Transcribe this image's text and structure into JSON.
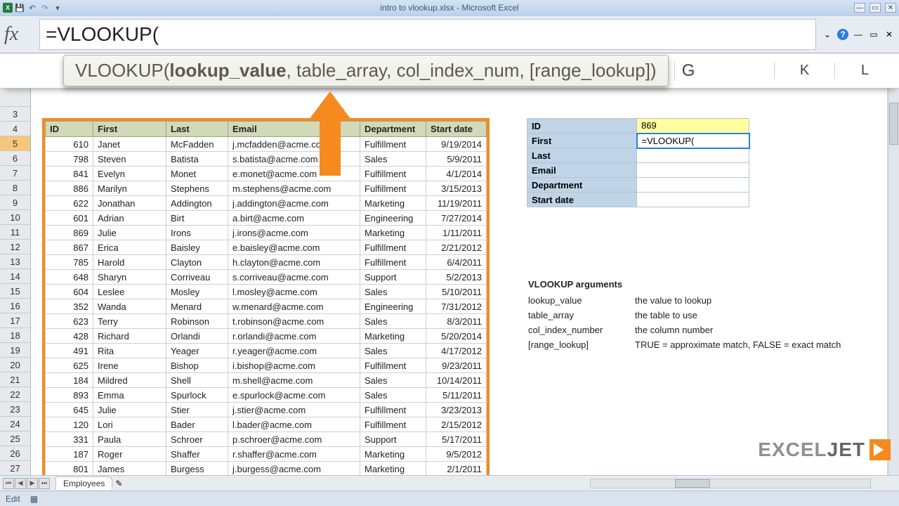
{
  "window": {
    "title": "intro to vlookup.xlsx - Microsoft Excel"
  },
  "formula_bar": {
    "fx": "fx",
    "value": "=VLOOKUP("
  },
  "tooltip": {
    "fn": "VLOOKUP(",
    "arg_bold": "lookup_value",
    "rest": ", table_array, col_index_num, [range_lookup])"
  },
  "col_headers_right": {
    "g": "G",
    "k": "K",
    "l": "L"
  },
  "row_numbers": [
    3,
    4,
    5,
    6,
    7,
    8,
    9,
    10,
    11,
    12,
    13,
    14,
    15,
    16,
    17,
    18,
    19,
    20,
    21,
    22,
    23,
    24,
    25,
    26,
    27
  ],
  "selected_row": 5,
  "table": {
    "headers": {
      "id": "ID",
      "first": "First",
      "last": "Last",
      "email": "Email",
      "dept": "Department",
      "date": "Start date"
    },
    "rows": [
      {
        "id": 610,
        "first": "Janet",
        "last": "McFadden",
        "email": "j.mcfadden@acme.co",
        "dept": "Fulfillment",
        "date": "9/19/2014"
      },
      {
        "id": 798,
        "first": "Steven",
        "last": "Batista",
        "email": "s.batista@acme.com",
        "dept": "Sales",
        "date": "5/9/2011"
      },
      {
        "id": 841,
        "first": "Evelyn",
        "last": "Monet",
        "email": "e.monet@acme.com",
        "dept": "Fulfillment",
        "date": "4/1/2014"
      },
      {
        "id": 886,
        "first": "Marilyn",
        "last": "Stephens",
        "email": "m.stephens@acme.com",
        "dept": "Fulfillment",
        "date": "3/15/2013"
      },
      {
        "id": 622,
        "first": "Jonathan",
        "last": "Addington",
        "email": "j.addington@acme.com",
        "dept": "Marketing",
        "date": "11/19/2011"
      },
      {
        "id": 601,
        "first": "Adrian",
        "last": "Birt",
        "email": "a.birt@acme.com",
        "dept": "Engineering",
        "date": "7/27/2014"
      },
      {
        "id": 869,
        "first": "Julie",
        "last": "Irons",
        "email": "j.irons@acme.com",
        "dept": "Marketing",
        "date": "1/11/2011"
      },
      {
        "id": 867,
        "first": "Erica",
        "last": "Baisley",
        "email": "e.baisley@acme.com",
        "dept": "Fulfillment",
        "date": "2/21/2012"
      },
      {
        "id": 785,
        "first": "Harold",
        "last": "Clayton",
        "email": "h.clayton@acme.com",
        "dept": "Fulfillment",
        "date": "6/4/2011"
      },
      {
        "id": 648,
        "first": "Sharyn",
        "last": "Corriveau",
        "email": "s.corriveau@acme.com",
        "dept": "Support",
        "date": "5/2/2013"
      },
      {
        "id": 604,
        "first": "Leslee",
        "last": "Mosley",
        "email": "l.mosley@acme.com",
        "dept": "Sales",
        "date": "5/10/2011"
      },
      {
        "id": 352,
        "first": "Wanda",
        "last": "Menard",
        "email": "w.menard@acme.com",
        "dept": "Engineering",
        "date": "7/31/2012"
      },
      {
        "id": 623,
        "first": "Terry",
        "last": "Robinson",
        "email": "t.robinson@acme.com",
        "dept": "Sales",
        "date": "8/3/2011"
      },
      {
        "id": 428,
        "first": "Richard",
        "last": "Orlandi",
        "email": "r.orlandi@acme.com",
        "dept": "Marketing",
        "date": "5/20/2014"
      },
      {
        "id": 491,
        "first": "Rita",
        "last": "Yeager",
        "email": "r.yeager@acme.com",
        "dept": "Sales",
        "date": "4/17/2012"
      },
      {
        "id": 625,
        "first": "Irene",
        "last": "Bishop",
        "email": "i.bishop@acme.com",
        "dept": "Fulfillment",
        "date": "9/23/2011"
      },
      {
        "id": 184,
        "first": "Mildred",
        "last": "Shell",
        "email": "m.shell@acme.com",
        "dept": "Sales",
        "date": "10/14/2011"
      },
      {
        "id": 893,
        "first": "Emma",
        "last": "Spurlock",
        "email": "e.spurlock@acme.com",
        "dept": "Sales",
        "date": "5/11/2011"
      },
      {
        "id": 645,
        "first": "Julie",
        "last": "Stier",
        "email": "j.stier@acme.com",
        "dept": "Fulfillment",
        "date": "3/23/2013"
      },
      {
        "id": 120,
        "first": "Lori",
        "last": "Bader",
        "email": "l.bader@acme.com",
        "dept": "Fulfillment",
        "date": "2/15/2012"
      },
      {
        "id": 331,
        "first": "Paula",
        "last": "Schroer",
        "email": "p.schroer@acme.com",
        "dept": "Support",
        "date": "5/17/2011"
      },
      {
        "id": 187,
        "first": "Roger",
        "last": "Shaffer",
        "email": "r.shaffer@acme.com",
        "dept": "Marketing",
        "date": "9/5/2012"
      },
      {
        "id": 801,
        "first": "James",
        "last": "Burgess",
        "email": "j.burgess@acme.com",
        "dept": "Marketing",
        "date": "2/1/2011"
      }
    ]
  },
  "lookup": {
    "labels": {
      "id": "ID",
      "first": "First",
      "last": "Last",
      "email": "Email",
      "dept": "Department",
      "date": "Start date"
    },
    "id_value": "869",
    "first_value": "=VLOOKUP("
  },
  "args": {
    "title": "VLOOKUP arguments",
    "rows": [
      {
        "name": "lookup_value",
        "desc": "the value to lookup"
      },
      {
        "name": "table_array",
        "desc": "the table to use"
      },
      {
        "name": "col_index_number",
        "desc": "the column number"
      },
      {
        "name": "[range_lookup]",
        "desc": "TRUE = approximate match, FALSE = exact match"
      }
    ]
  },
  "sheet_tab": "Employees",
  "status": "Edit",
  "logo": {
    "a": "EXCEL",
    "b": "JET"
  }
}
